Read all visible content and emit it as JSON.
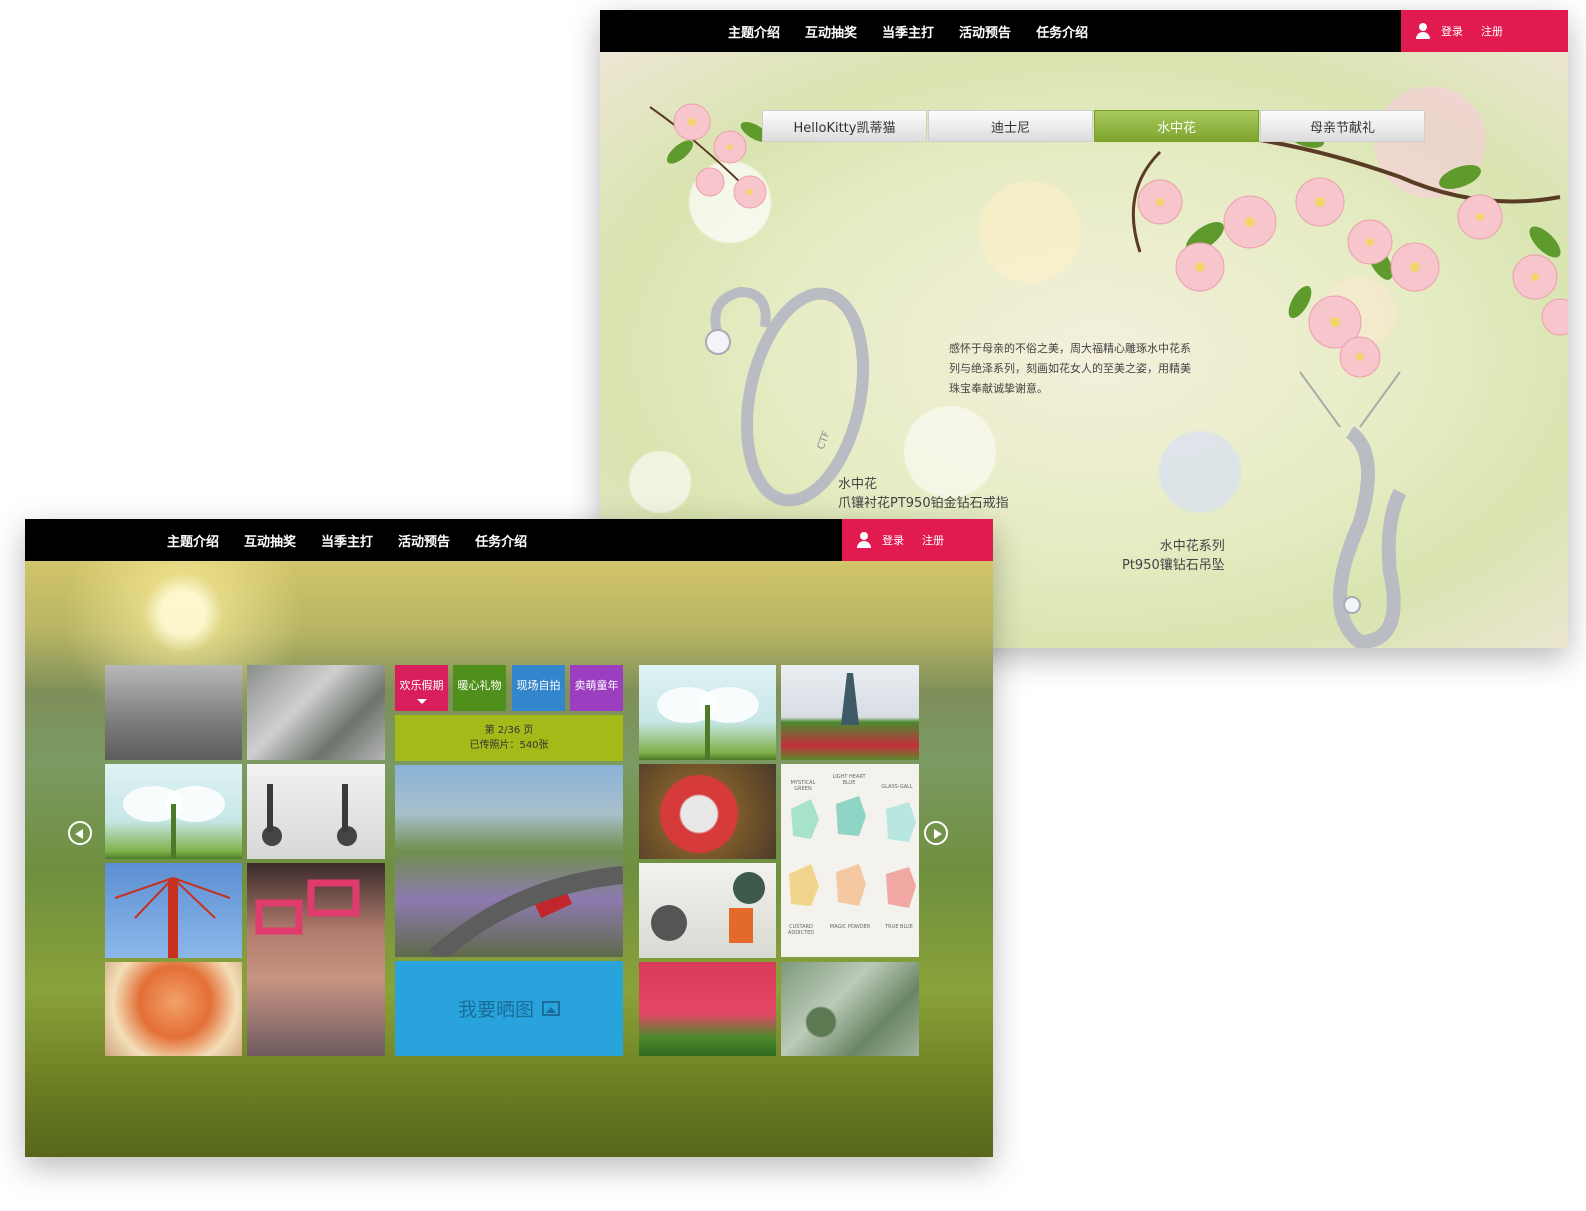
{
  "nav": {
    "items": [
      "主题介绍",
      "互动抽奖",
      "当季主打",
      "活动预告",
      "任务介绍"
    ]
  },
  "auth": {
    "login": "登录",
    "register": "注册"
  },
  "jewelry": {
    "tabs": [
      "HelloKitty凯蒂猫",
      "迪士尼",
      "水中花",
      "母亲节献礼"
    ],
    "active_tab": "水中花",
    "description": "感怀于母亲的不俗之美，周大福精心雕琢水中花系列与绝泽系列，刻画如花女人的至美之姿，用精美珠宝奉献诚挚谢意。",
    "ring_title": "水中花",
    "ring_name": "爪镶衬花PT950铂金钻石戒指",
    "pendant_title": "水中花系列",
    "pendant_name": "Pt950镶钻石吊坠",
    "ring_engraving": "CTF"
  },
  "gallery": {
    "categories": [
      {
        "label": "欢乐假期",
        "color": "#d81e5b"
      },
      {
        "label": "暖心礼物",
        "color": "#4f8f1b"
      },
      {
        "label": "现场自拍",
        "color": "#3385cc"
      },
      {
        "label": "卖萌童年",
        "color": "#9b3ec0"
      }
    ],
    "page_info": "第 2/36 页",
    "uploaded_count": "已传照片：540张",
    "upload_button": "我要晒图",
    "swatch_labels": [
      "MYSTICAL GREEN",
      "LIGHT HEART BLUE",
      "GLASS-GALL",
      "CUSTARD ADDICTED",
      "MAGIC POWDER",
      "TRUE BLUE"
    ]
  }
}
